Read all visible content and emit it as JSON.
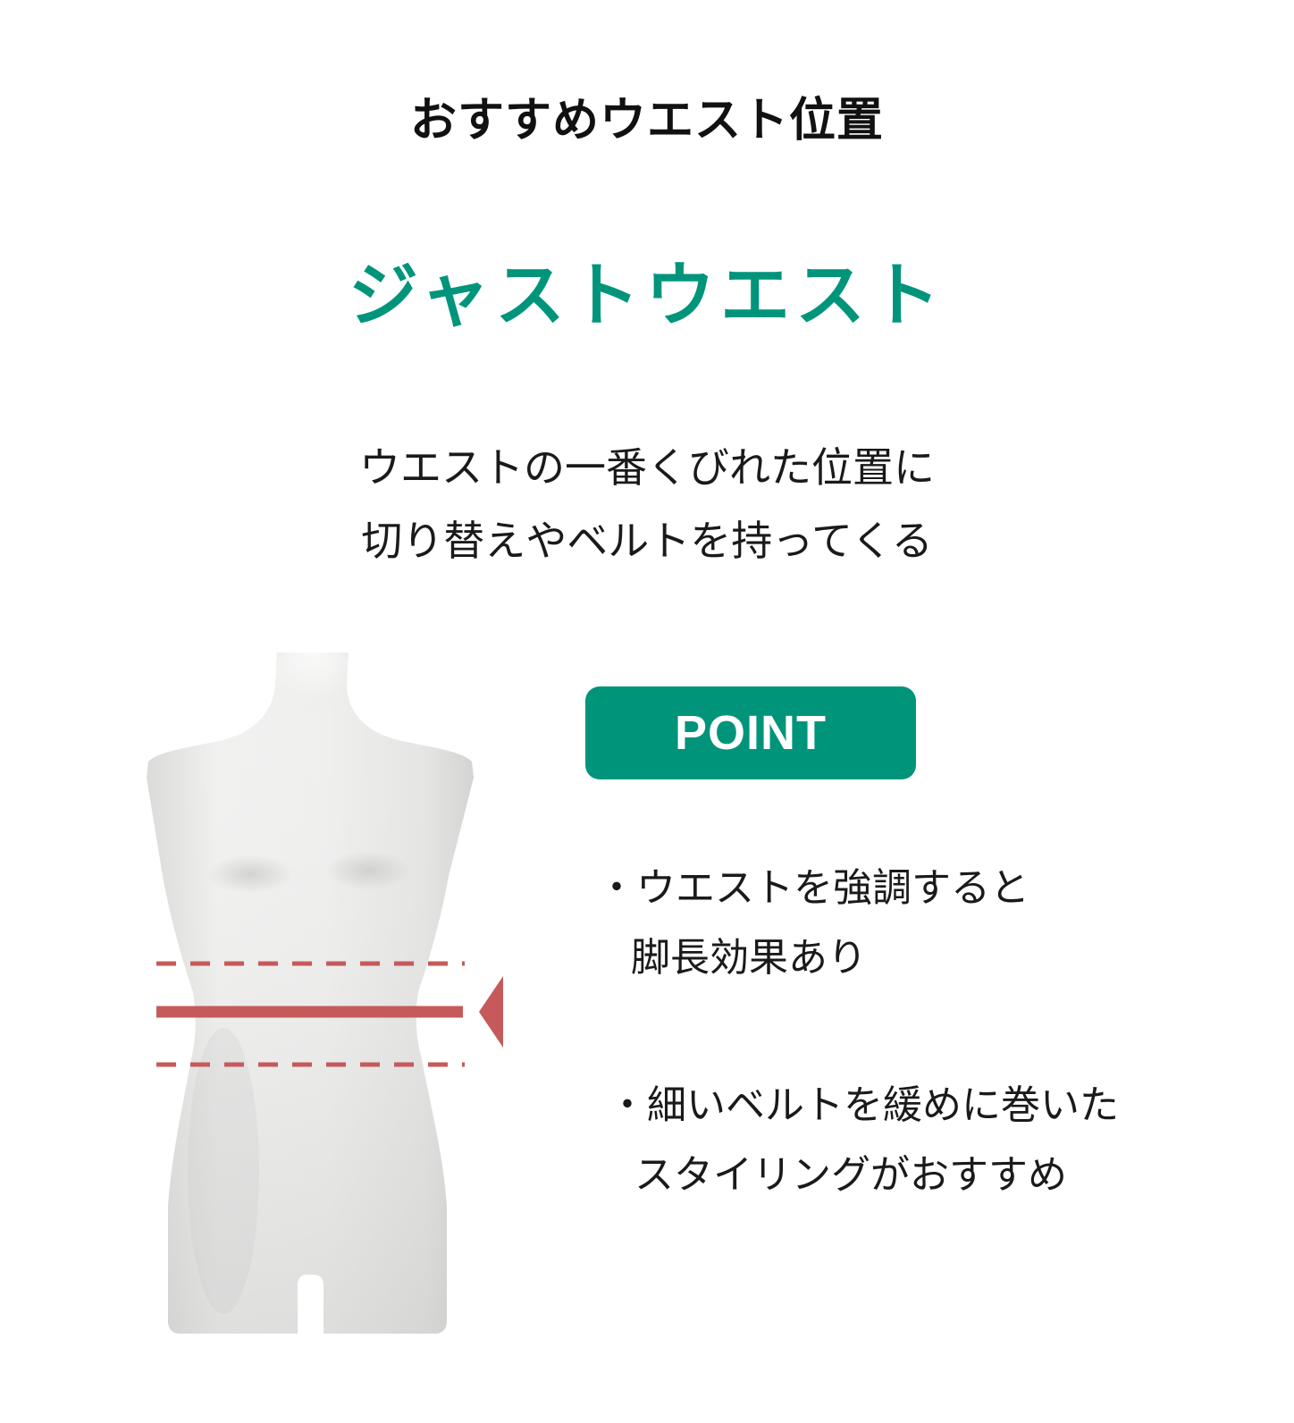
{
  "heading": "おすすめウエスト位置",
  "subheading": "ジャストウエスト",
  "description": {
    "line1": "ウエストの一番くびれた位置に",
    "line2": "切り替えやベルトを持ってくる"
  },
  "point": {
    "label": "POINT",
    "items": [
      {
        "line1": "・ウエストを強調すると",
        "line2": "脚長効果あり"
      },
      {
        "line1": "・細いベルトを緩めに巻いた",
        "line2": "スタイリングがおすすめ"
      }
    ]
  },
  "colors": {
    "accent": "#00957b",
    "waist_marker": "#c65a5a",
    "mannequin": "#ececeb"
  },
  "icons": {
    "figure": "mannequin-torso",
    "marker": "waist-arrow-icon"
  }
}
